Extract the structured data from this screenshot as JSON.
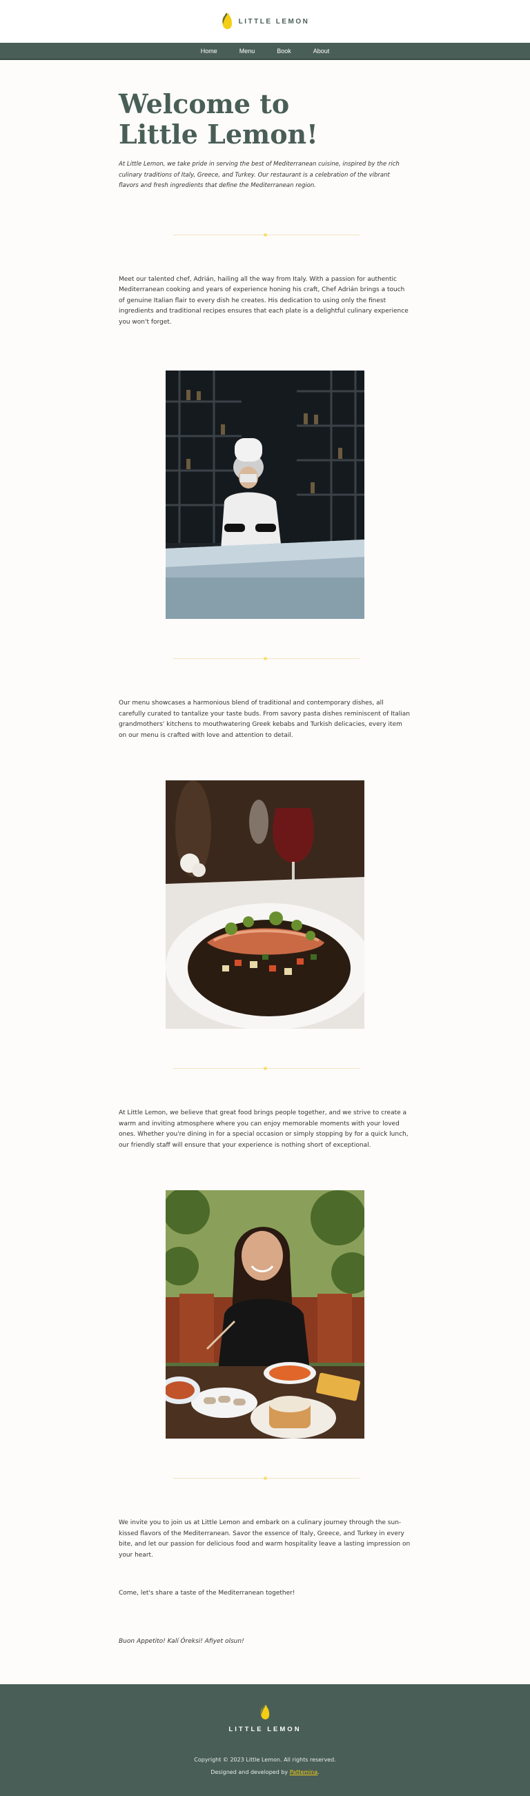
{
  "brand": {
    "name": "LITTLE LEMON",
    "logo_icon": "lemon-icon",
    "colors": {
      "primary": "#495e57",
      "accent": "#f4ce14"
    }
  },
  "nav": {
    "items": [
      {
        "label": "Home"
      },
      {
        "label": "Menu"
      },
      {
        "label": "Book"
      },
      {
        "label": "About"
      }
    ]
  },
  "page": {
    "title": "Welcome to Little Lemon!",
    "intro": "At Little Lemon, we take pride in serving the best of Mediterranean cuisine, inspired by the rich culinary traditions of Italy, Greece, and Turkey. Our restaurant is a celebration of the vibrant flavors and fresh ingredients that define the Mediterranean region.",
    "chef_paragraph": "Meet our talented chef, Adrián, hailing all the way from Italy. With a passion for authentic Mediterranean cooking and years of experience honing his craft, Chef Adrián brings a touch of genuine Italian flair to every dish he creates. His dedication to using only the finest ingredients and traditional recipes ensures that each plate is a delightful culinary experience you won't forget.",
    "menu_paragraph": "Our menu showcases a harmonious blend of traditional and contemporary dishes, all carefully curated to tantalize your taste buds. From savory pasta dishes reminiscent of Italian grandmothers' kitchens to mouthwatering Greek kebabs and Turkish delicacies, every item on our menu is crafted with love and attention to detail.",
    "people_paragraph": "At Little Lemon, we believe that great food brings people together, and we strive to create a warm and inviting atmosphere where you can enjoy memorable moments with your loved ones. Whether you're dining in for a special occasion or simply stopping by for a quick lunch, our friendly staff will ensure that your experience is nothing short of exceptional.",
    "invite_paragraph": "We invite you to join us at Little Lemon and embark on a culinary journey through the sun-kissed flavors of the Mediterranean. Savor the essence of Italy, Greece, and Turkey in every bite, and let our passion for delicious food and warm hospitality leave a lasting impression on your heart.",
    "share_line": "Come, let's share a taste of the Mediterranean together!",
    "closing_line": "Buon Appetito! Kalí Óreksi! Afiyet olsun!"
  },
  "footer": {
    "brand": "LITTLE LEMON",
    "copyright": "Copyright © 2023 Little Lemon. All rights reserved.",
    "credit_prefix": "Designed and developed by ",
    "credit_link": "Pattemina",
    "credit_suffix": "."
  }
}
